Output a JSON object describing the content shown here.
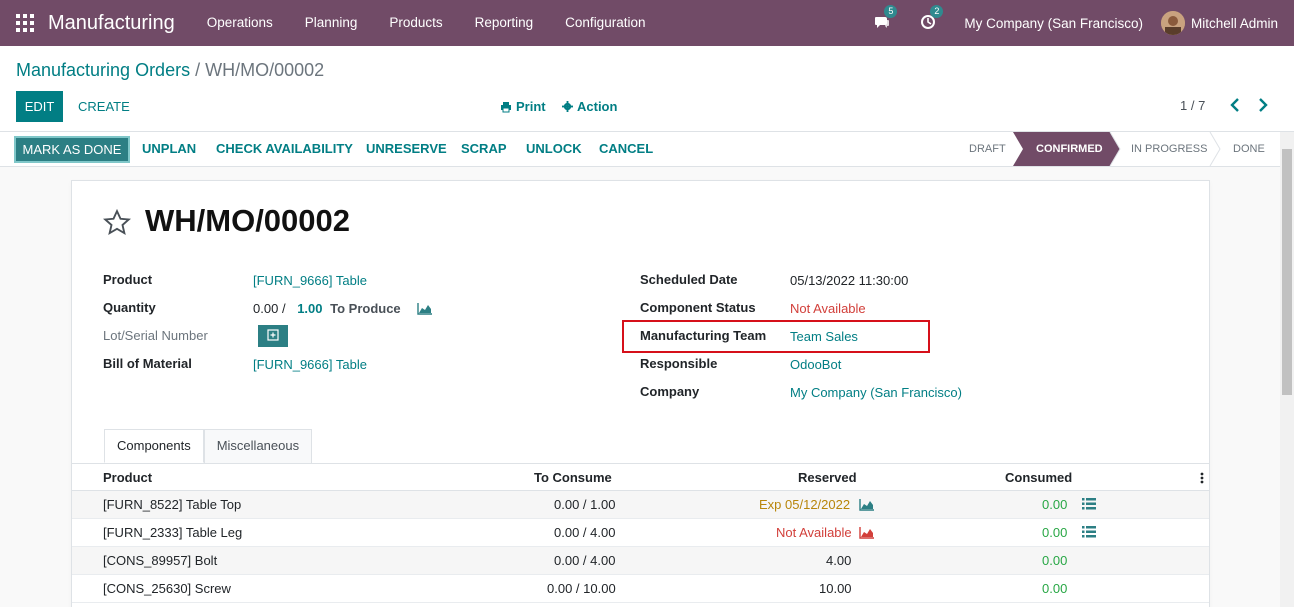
{
  "navbar": {
    "brand": "Manufacturing",
    "menu": [
      "Operations",
      "Planning",
      "Products",
      "Reporting",
      "Configuration"
    ],
    "messages_count": "5",
    "activities_count": "2",
    "company": "My Company (San Francisco)",
    "user": "Mitchell Admin",
    "colors": {
      "primary": "#714b67",
      "accent": "#017e84"
    }
  },
  "breadcrumb": {
    "parent": "Manufacturing Orders",
    "separator": "/",
    "current": "WH/MO/00002"
  },
  "toolbar": {
    "edit_label": "EDIT",
    "create_label": "CREATE",
    "print_label": "Print",
    "action_label": "Action",
    "pager_value": "1 / 7"
  },
  "statusbar": {
    "buttons": [
      "MARK AS DONE",
      "UNPLAN",
      "CHECK AVAILABILITY",
      "UNRESERVE",
      "SCRAP",
      "UNLOCK",
      "CANCEL"
    ],
    "stages": [
      "DRAFT",
      "CONFIRMED",
      "IN PROGRESS",
      "DONE"
    ],
    "active_stage": "CONFIRMED"
  },
  "form": {
    "title": "WH/MO/00002",
    "left": {
      "product_label": "Product",
      "product_value": "[FURN_9666] Table",
      "quantity_label": "Quantity",
      "quantity_done": "0.00",
      "quantity_sep": "/",
      "quantity_target": "1.00",
      "quantity_suffix": "To Produce",
      "lot_label": "Lot/Serial Number",
      "bom_label": "Bill of Material",
      "bom_value": "[FURN_9666] Table"
    },
    "right": {
      "scheduled_label": "Scheduled Date",
      "scheduled_value": "05/13/2022 11:30:00",
      "component_status_label": "Component Status",
      "component_status_value": "Not Available",
      "team_label": "Manufacturing Team",
      "team_value": "Team Sales",
      "responsible_label": "Responsible",
      "responsible_value": "OdooBot",
      "company_label": "Company",
      "company_value": "My Company (San Francisco)"
    }
  },
  "tabs": [
    "Components",
    "Miscellaneous"
  ],
  "components_table": {
    "headers": [
      "Product",
      "To Consume",
      "Reserved",
      "Consumed"
    ],
    "rows": [
      {
        "product": "[FURN_8522] Table Top",
        "to_consume": "0.00 / 1.00",
        "reserved": "Exp 05/12/2022",
        "consumed": "0.00"
      },
      {
        "product": "[FURN_2333] Table Leg",
        "to_consume": "0.00 / 4.00",
        "reserved": "Not Available",
        "consumed": "0.00"
      },
      {
        "product": "[CONS_89957] Bolt",
        "to_consume": "0.00 / 4.00",
        "reserved": "4.00",
        "consumed": "0.00"
      },
      {
        "product": "[CONS_25630] Screw",
        "to_consume": "0.00 / 10.00",
        "reserved": "10.00",
        "consumed": "0.00"
      }
    ]
  }
}
